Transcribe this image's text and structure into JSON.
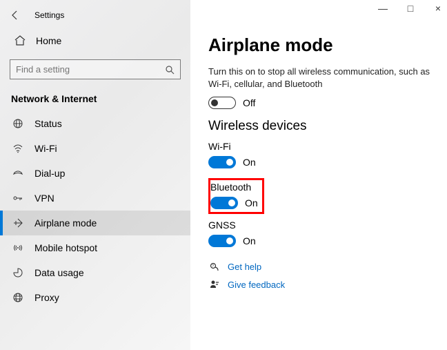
{
  "window": {
    "title": "Settings",
    "minimize": "—",
    "maximize": "□",
    "close": "×"
  },
  "home_label": "Home",
  "search_placeholder": "Find a setting",
  "section_label": "Network & Internet",
  "nav": [
    {
      "label": "Status"
    },
    {
      "label": "Wi-Fi"
    },
    {
      "label": "Dial-up"
    },
    {
      "label": "VPN"
    },
    {
      "label": "Airplane mode"
    },
    {
      "label": "Mobile hotspot"
    },
    {
      "label": "Data usage"
    },
    {
      "label": "Proxy"
    }
  ],
  "page": {
    "title": "Airplane mode",
    "description": "Turn this on to stop all wireless communication, such as Wi-Fi, cellular, and Bluetooth",
    "main_toggle_state": "Off",
    "wireless_heading": "Wireless devices",
    "devices": {
      "wifi": {
        "label": "Wi-Fi",
        "state": "On"
      },
      "bluetooth": {
        "label": "Bluetooth",
        "state": "On"
      },
      "gnss": {
        "label": "GNSS",
        "state": "On"
      }
    },
    "help_label": "Get help",
    "feedback_label": "Give feedback"
  },
  "colors": {
    "accent": "#0078d7",
    "highlight": "#ff0000"
  }
}
